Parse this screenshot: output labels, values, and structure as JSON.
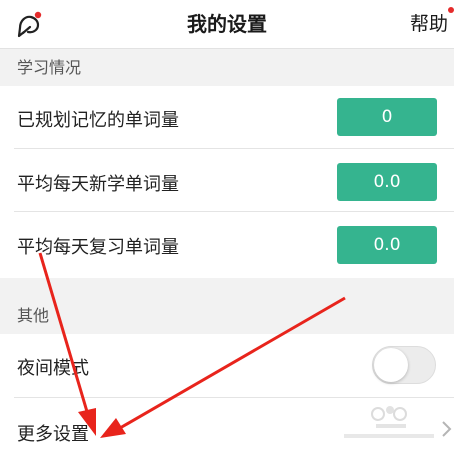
{
  "header": {
    "title": "我的设置",
    "help_label": "帮助",
    "left_icon": "cat-mascot-icon"
  },
  "sections": {
    "study": {
      "title": "学习情况",
      "rows": [
        {
          "label": "已规划记忆的单词量",
          "value": "0"
        },
        {
          "label": "平均每天新学单词量",
          "value": "0.0"
        },
        {
          "label": "平均每天复习单词量",
          "value": "0.0"
        }
      ]
    },
    "other": {
      "title": "其他",
      "night_mode": {
        "label": "夜间模式",
        "enabled": false
      },
      "more_settings": {
        "label": "更多设置"
      }
    }
  },
  "colors": {
    "accent_green": "#35b48f",
    "notification_red": "#e52b2b",
    "annotation_arrow_red": "#e8241c"
  }
}
